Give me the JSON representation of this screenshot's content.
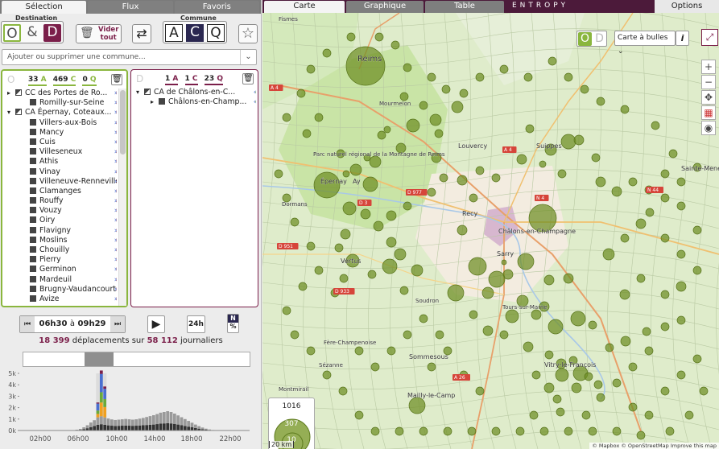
{
  "left_tabs": [
    "Sélection",
    "Flux",
    "Favoris"
  ],
  "toolbar": {
    "destination_label": "Destination",
    "commune_label": "Commune",
    "o_letter": "O",
    "amp_letter": "&",
    "d_letter": "D",
    "clear_label_1": "Vider",
    "clear_label_2": "tout",
    "a_letter": "A",
    "c_letter": "C",
    "q_letter": "Q",
    "star": "☆",
    "swap": "⇄"
  },
  "commune_select": {
    "placeholder": "Ajouter ou supprimer une commune...",
    "chevron": "⌄"
  },
  "origin_panel": {
    "tag": "O",
    "counts": [
      {
        "num": "33",
        "unit": "A"
      },
      {
        "num": "469",
        "unit": "C"
      },
      {
        "num": "0",
        "unit": "Q"
      }
    ],
    "rows": [
      {
        "indent": 0,
        "toggle": "▸",
        "box": "half",
        "label": "CC des Portes de Ro...",
        "arrows": "»»"
      },
      {
        "indent": 1,
        "toggle": "",
        "box": "full",
        "label": "Romilly-sur-Seine",
        "arrows": "»»"
      },
      {
        "indent": 0,
        "toggle": "▾",
        "box": "half",
        "label": "CA Épernay, Coteaux...",
        "arrows": "»»"
      },
      {
        "indent": 1,
        "toggle": "",
        "box": "full",
        "label": "Villers-aux-Bois",
        "arrows": "»»"
      },
      {
        "indent": 1,
        "toggle": "",
        "box": "full",
        "label": "Mancy",
        "arrows": "»»"
      },
      {
        "indent": 1,
        "toggle": "",
        "box": "full",
        "label": "Cuis",
        "arrows": "»»"
      },
      {
        "indent": 1,
        "toggle": "",
        "box": "full",
        "label": "Villeseneux",
        "arrows": "»»"
      },
      {
        "indent": 1,
        "toggle": "",
        "box": "full",
        "label": "Athis",
        "arrows": "»»"
      },
      {
        "indent": 1,
        "toggle": "",
        "box": "full",
        "label": "Vinay",
        "arrows": "»»"
      },
      {
        "indent": 1,
        "toggle": "",
        "box": "full",
        "label": "Villeneuve-Renneville...",
        "arrows": "»»"
      },
      {
        "indent": 1,
        "toggle": "",
        "box": "full",
        "label": "Clamanges",
        "arrows": "»»"
      },
      {
        "indent": 1,
        "toggle": "",
        "box": "full",
        "label": "Rouffy",
        "arrows": "»»"
      },
      {
        "indent": 1,
        "toggle": "",
        "box": "full",
        "label": "Vouzy",
        "arrows": "»»"
      },
      {
        "indent": 1,
        "toggle": "",
        "box": "full",
        "label": "Oiry",
        "arrows": "»»"
      },
      {
        "indent": 1,
        "toggle": "",
        "box": "full",
        "label": "Flavigny",
        "arrows": "»»"
      },
      {
        "indent": 1,
        "toggle": "",
        "box": "full",
        "label": "Moslins",
        "arrows": "»»"
      },
      {
        "indent": 1,
        "toggle": "",
        "box": "full",
        "label": "Chouilly",
        "arrows": "»»"
      },
      {
        "indent": 1,
        "toggle": "",
        "box": "full",
        "label": "Pierry",
        "arrows": "»»"
      },
      {
        "indent": 1,
        "toggle": "",
        "box": "full",
        "label": "Germinon",
        "arrows": "»»"
      },
      {
        "indent": 1,
        "toggle": "",
        "box": "full",
        "label": "Mardeuil",
        "arrows": "»»"
      },
      {
        "indent": 1,
        "toggle": "",
        "box": "full",
        "label": "Brugny-Vaudancourt",
        "arrows": "»»"
      },
      {
        "indent": 1,
        "toggle": "",
        "box": "full",
        "label": "Avize",
        "arrows": "»»"
      }
    ]
  },
  "dest_panel": {
    "tag": "D",
    "counts": [
      {
        "num": "1",
        "unit": "A"
      },
      {
        "num": "1",
        "unit": "C"
      },
      {
        "num": "23",
        "unit": "Q"
      }
    ],
    "rows": [
      {
        "indent": 0,
        "toggle": "▾",
        "box": "half",
        "label": "CA de Châlons-en-C...",
        "arrows": "««"
      },
      {
        "indent": 1,
        "toggle": "▸",
        "box": "full",
        "label": "Châlons-en-Champ...",
        "arrows": "««"
      }
    ]
  },
  "time": {
    "start": "06h30",
    "sep": "à",
    "end": "09h29",
    "prev": "⏮",
    "next": "⏭",
    "play": "▶",
    "h24": "24h",
    "n_label": "N",
    "pct_label": "%"
  },
  "stats": {
    "trips": "18 399",
    "trips_label": "déplacements sur",
    "total": "58 112",
    "total_label": "journaliers"
  },
  "chart_data": {
    "type": "bar",
    "title": "",
    "ylabel": "",
    "ylim": [
      0,
      5000
    ],
    "yticks": [
      "5k",
      "4k",
      "3k",
      "2k",
      "1k",
      "0k"
    ],
    "xticks": [
      "02h00",
      "06h00",
      "10h00",
      "14h00",
      "18h00",
      "22h00"
    ],
    "selected_range": [
      "06h30",
      "09h29"
    ],
    "colors": {
      "blue": "#4a6fd0",
      "green": "#6aaa3a",
      "orange": "#f0a020",
      "maroon": "#7b1f4a",
      "dark": "#333333",
      "grey": "#9a9a9a"
    },
    "series": [
      {
        "name": "",
        "color": "#333333",
        "values": [
          0,
          0,
          0,
          0,
          0,
          0,
          0,
          0,
          0,
          0,
          0,
          0,
          0,
          0,
          0,
          0,
          30,
          60,
          120,
          200,
          300,
          400,
          500,
          550,
          500,
          450,
          420,
          400,
          410,
          420,
          430,
          420,
          410,
          420,
          440,
          460,
          480,
          500,
          520,
          560,
          600,
          620,
          640,
          620,
          580,
          520,
          460,
          400,
          340,
          280,
          220,
          160,
          110,
          70,
          40,
          20,
          10,
          0,
          0,
          0,
          0,
          0,
          0,
          0,
          0,
          0
        ]
      },
      {
        "name": "",
        "color": "#9a9a9a",
        "values": [
          0,
          0,
          0,
          0,
          0,
          0,
          0,
          0,
          0,
          0,
          0,
          0,
          0,
          0,
          0,
          0,
          40,
          80,
          160,
          260,
          400,
          500,
          650,
          700,
          650,
          600,
          550,
          520,
          540,
          560,
          580,
          560,
          540,
          560,
          600,
          640,
          700,
          760,
          820,
          880,
          960,
          1000,
          1050,
          1000,
          900,
          800,
          700,
          600,
          500,
          400,
          300,
          220,
          150,
          90,
          50,
          20,
          10,
          0,
          0,
          0,
          0,
          0,
          0,
          0,
          0,
          0
        ]
      },
      {
        "name": "",
        "color": "#f0a020",
        "values": [
          0,
          0,
          0,
          0,
          0,
          0,
          0,
          0,
          0,
          0,
          0,
          0,
          0,
          0,
          0,
          0,
          0,
          0,
          0,
          0,
          0,
          0,
          300,
          1200,
          900,
          0,
          0,
          0,
          0,
          0,
          0,
          0,
          0,
          0,
          0,
          0,
          0,
          0,
          0,
          0,
          0,
          0,
          0,
          0,
          0,
          0,
          0,
          0,
          0,
          0,
          0,
          0,
          0,
          0,
          0,
          0,
          0,
          0,
          0,
          0,
          0,
          0,
          0,
          0,
          0,
          0
        ]
      },
      {
        "name": "",
        "color": "#6aaa3a",
        "values": [
          0,
          0,
          0,
          0,
          0,
          0,
          0,
          0,
          0,
          0,
          0,
          0,
          0,
          0,
          0,
          0,
          0,
          0,
          0,
          0,
          0,
          0,
          300,
          900,
          700,
          0,
          0,
          0,
          0,
          0,
          0,
          0,
          0,
          0,
          0,
          0,
          0,
          0,
          0,
          0,
          0,
          0,
          0,
          0,
          0,
          0,
          0,
          0,
          0,
          0,
          0,
          0,
          0,
          0,
          0,
          0,
          0,
          0,
          0,
          0,
          0,
          0,
          0,
          0,
          0,
          0
        ]
      },
      {
        "name": "",
        "color": "#4a6fd0",
        "values": [
          0,
          0,
          0,
          0,
          0,
          0,
          0,
          0,
          0,
          0,
          0,
          0,
          0,
          0,
          0,
          0,
          0,
          0,
          0,
          0,
          0,
          0,
          600,
          1600,
          900,
          0,
          0,
          0,
          0,
          0,
          0,
          0,
          0,
          0,
          0,
          0,
          0,
          0,
          0,
          0,
          0,
          0,
          0,
          0,
          0,
          0,
          0,
          0,
          0,
          0,
          0,
          0,
          0,
          0,
          0,
          0,
          0,
          0,
          0,
          0,
          0,
          0,
          0,
          0,
          0,
          0
        ]
      },
      {
        "name": "",
        "color": "#7b1f4a",
        "values": [
          0,
          0,
          0,
          0,
          0,
          0,
          0,
          0,
          0,
          0,
          0,
          0,
          0,
          0,
          0,
          0,
          0,
          0,
          0,
          0,
          0,
          0,
          100,
          300,
          200,
          0,
          0,
          0,
          0,
          0,
          0,
          0,
          0,
          0,
          0,
          0,
          0,
          0,
          0,
          0,
          0,
          0,
          0,
          0,
          0,
          0,
          0,
          0,
          0,
          0,
          0,
          0,
          0,
          0,
          0,
          0,
          0,
          0,
          0,
          0,
          0,
          0,
          0,
          0,
          0,
          0
        ]
      }
    ]
  },
  "right_tabs": [
    "Carte",
    "Graphique",
    "Table"
  ],
  "brand": "ENTROPY",
  "options_label": "Options",
  "map": {
    "od_o": "O",
    "od_d": "D",
    "mode": "Carte à bulles",
    "mode_chev": "⌄",
    "info": "i",
    "expand": "⤢",
    "zoom_in": "+",
    "zoom_out": "−",
    "place_labels": [
      "Reims",
      "Épernay",
      "Ay",
      "Châlons-en-Champagne",
      "Louvercy",
      "Vertus",
      "Suippes",
      "Mailly-le-Camp",
      "Sommesous",
      "Recy",
      "Sarry",
      "Vitry-le-François",
      "Fismes",
      "Sainte-Menehould",
      "Parc naturel régional de la Montagne de Reims",
      "Dormans",
      "Montmirail",
      "Sézanne",
      "Fère-Champenoise",
      "Soudron",
      "Tours-sur-Marne",
      "Mourmelon"
    ],
    "road_labels": [
      "A 4",
      "A 26",
      "N 44",
      "D 951",
      "D 933",
      "N 4",
      "A 4",
      "D 977",
      "D 3"
    ],
    "legend": {
      "max": "1016",
      "mid": "307",
      "min": "10"
    },
    "scale": "20 km",
    "attribution": "© Mapbox © OpenStreetMap Improve this map"
  }
}
